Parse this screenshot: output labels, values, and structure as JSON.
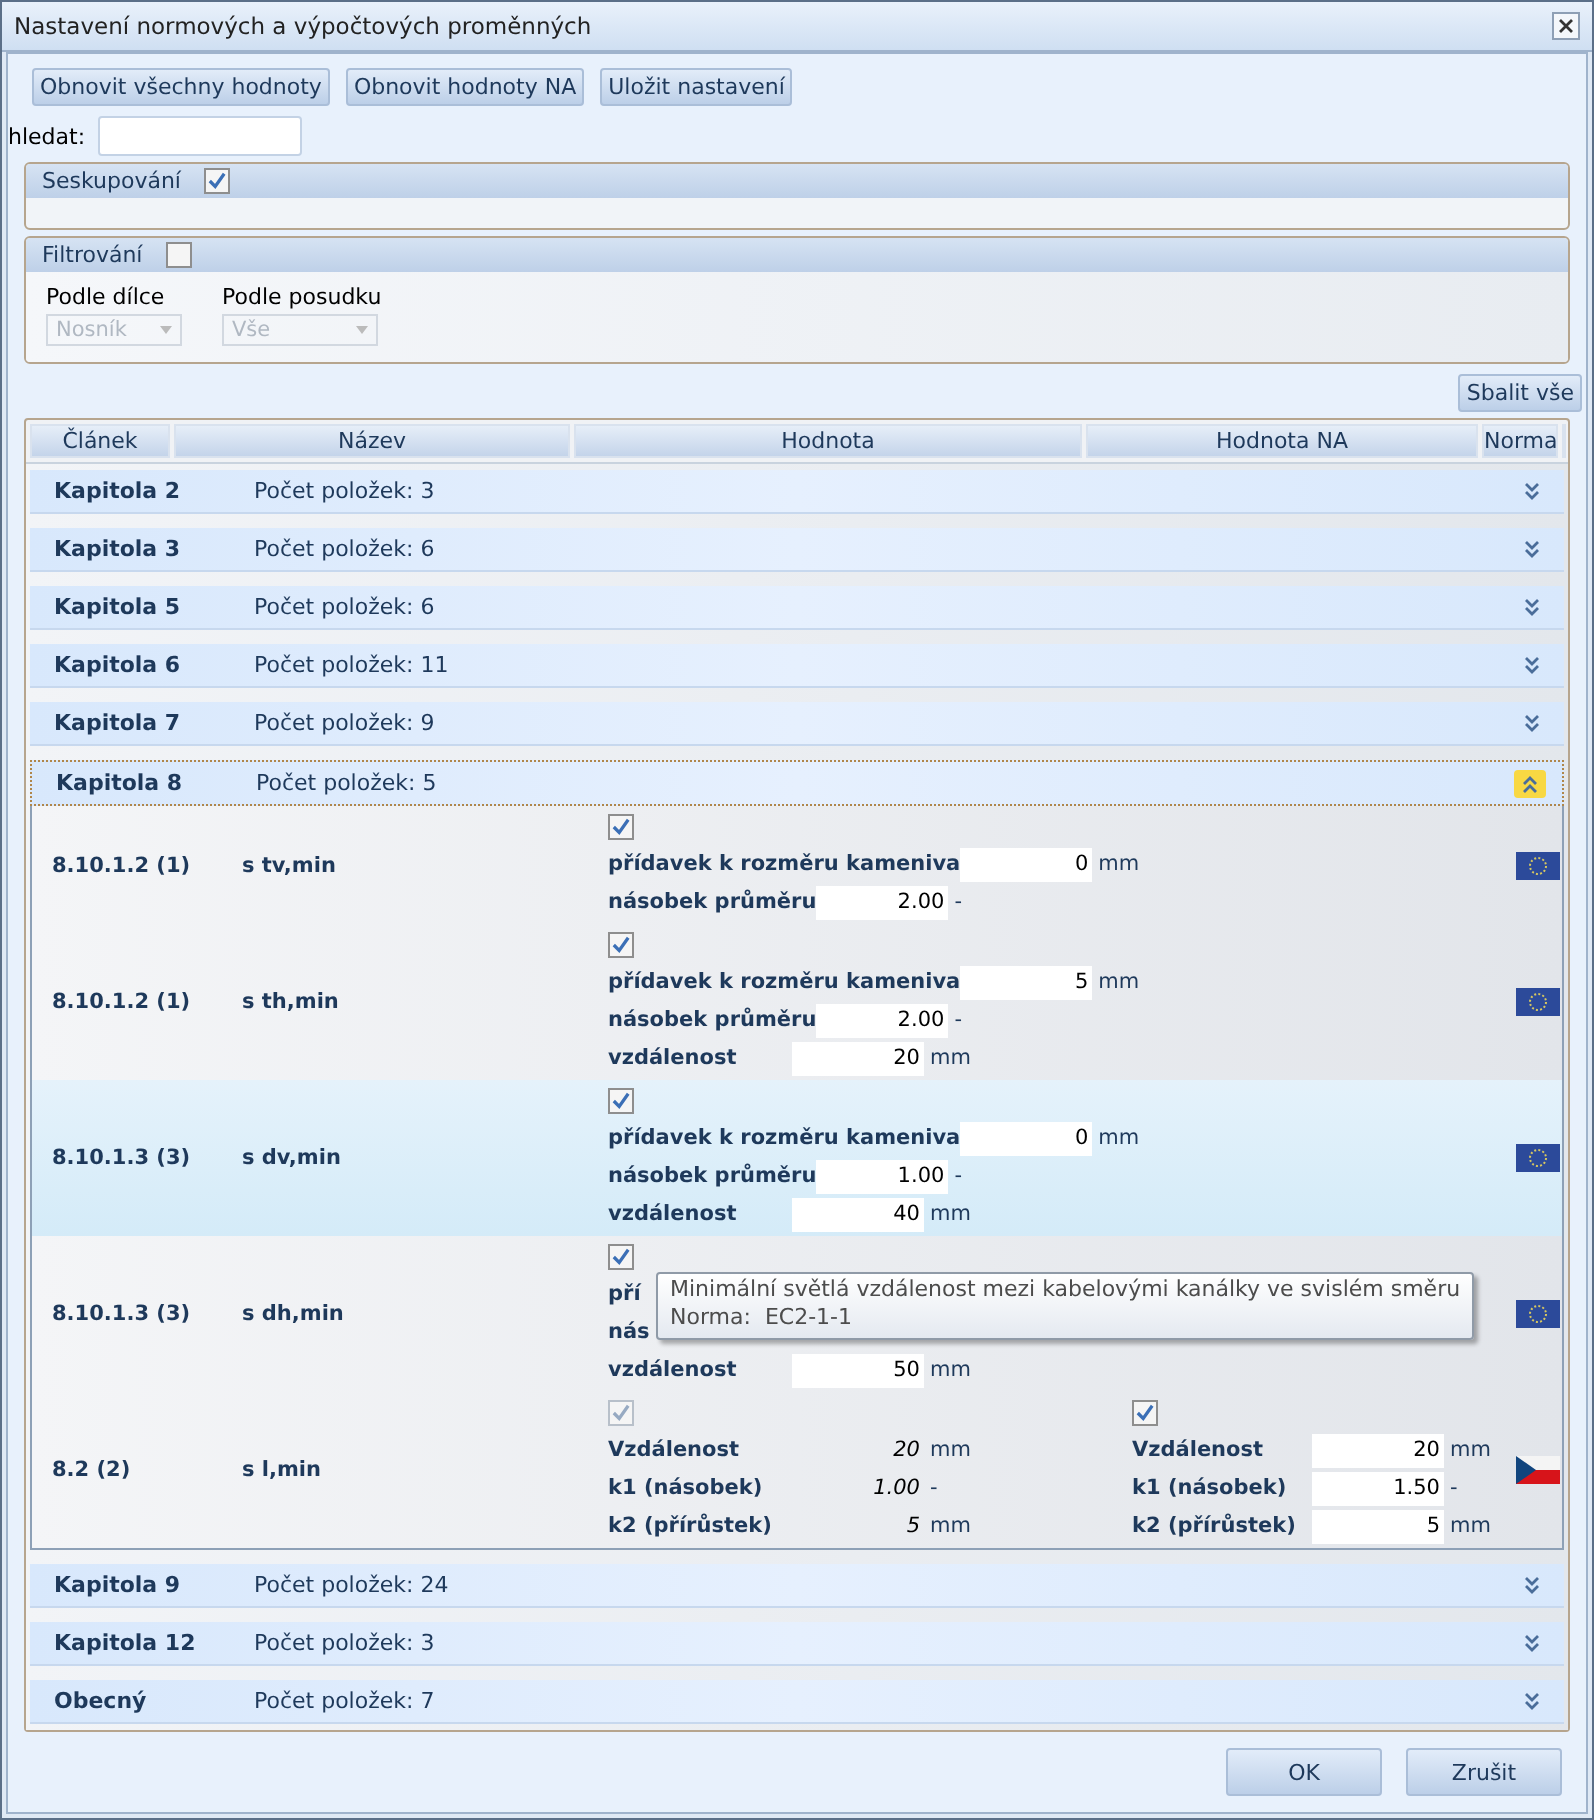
{
  "window": {
    "title": "Nastavení normových a výpočtových proměnných"
  },
  "toolbar": [
    "Obnovit všechny hodnoty",
    "Obnovit hodnoty NA",
    "Uložit nastavení"
  ],
  "search": {
    "label": "hledat:"
  },
  "grouping": {
    "title": "Seskupování",
    "checked": true
  },
  "filtering": {
    "title": "Filtrování",
    "checked": false,
    "filters": [
      {
        "label": "Podle dílce",
        "value": "Nosník",
        "disabled": true
      },
      {
        "label": "Podle posudku",
        "value": "Vše",
        "disabled": true
      }
    ]
  },
  "collapse_button": "Sbalit vše",
  "columns": [
    "Článek",
    "Název",
    "Hodnota",
    "Hodnota NA",
    "Norma"
  ],
  "groups": [
    {
      "name": "Kapitola 2",
      "count_label": "Počet položek:",
      "count": "3",
      "expanded": false
    },
    {
      "name": "Kapitola 3",
      "count_label": "Počet položek:",
      "count": "6",
      "expanded": false
    },
    {
      "name": "Kapitola 5",
      "count_label": "Počet položek:",
      "count": "6",
      "expanded": false
    },
    {
      "name": "Kapitola 6",
      "count_label": "Počet položek:",
      "count": "11",
      "expanded": false
    },
    {
      "name": "Kapitola 7",
      "count_label": "Počet položek:",
      "count": "9",
      "expanded": false
    },
    {
      "name": "Kapitola 8",
      "count_label": "Počet položek:",
      "count": "5",
      "expanded": true,
      "items": [
        {
          "article": "8.10.1.2 (1)",
          "name": "s tv,min",
          "selected": false,
          "kind": "eu",
          "value": {
            "checked": true,
            "disabled": false,
            "params": [
              {
                "label": "přídavek k rozměru kameniva",
                "value": "0",
                "unit": "mm"
              },
              {
                "label": "násobek průměru",
                "value": "2.00",
                "unit": "-"
              }
            ]
          }
        },
        {
          "article": "8.10.1.2 (1)",
          "name": "s th,min",
          "selected": false,
          "kind": "eu",
          "value": {
            "checked": true,
            "disabled": false,
            "params": [
              {
                "label": "přídavek k rozměru kameniva",
                "value": "5",
                "unit": "mm"
              },
              {
                "label": "násobek průměru",
                "value": "2.00",
                "unit": "-"
              },
              {
                "label": "vzdálenost",
                "value": "20",
                "unit": "mm"
              }
            ]
          }
        },
        {
          "article": "8.10.1.3 (3)",
          "name": "s dv,min",
          "selected": true,
          "kind": "eu",
          "value": {
            "checked": true,
            "disabled": false,
            "params": [
              {
                "label": "přídavek k rozměru kameniva",
                "value": "0",
                "unit": "mm"
              },
              {
                "label": "násobek průměru",
                "value": "1.00",
                "unit": "-"
              },
              {
                "label": "vzdálenost",
                "value": "40",
                "unit": "mm"
              }
            ]
          }
        },
        {
          "article": "8.10.1.3 (3)",
          "name": "s dh,min",
          "selected": false,
          "kind": "eu",
          "value": {
            "checked": true,
            "disabled": false,
            "params": [
              {
                "label": "pří"
              },
              {
                "label": "nás"
              },
              {
                "label": "vzdálenost",
                "value": "50",
                "unit": "mm"
              }
            ]
          },
          "tooltip": {
            "text": "Minimální světlá vzdálenost mezi kabelovými kanálky ve svislém směru",
            "norma_label": "Norma:",
            "norma": "EC2-1-1"
          }
        },
        {
          "article": "8.2 (2)",
          "name": "s l,min",
          "selected": false,
          "kind": "cz",
          "value": {
            "checked": true,
            "disabled": true,
            "params": [
              {
                "label": "Vzdálenost",
                "value": "20",
                "unit": "mm"
              },
              {
                "label": "k1 (násobek)",
                "value": "1.00",
                "unit": "-"
              },
              {
                "label": "k2 (přírůstek)",
                "value": "5",
                "unit": "mm"
              }
            ]
          },
          "na": {
            "checked": true,
            "disabled": false,
            "params": [
              {
                "label": "Vzdálenost",
                "value": "20",
                "unit": "mm"
              },
              {
                "label": "k1 (násobek)",
                "value": "1.50",
                "unit": "-"
              },
              {
                "label": "k2 (přírůstek)",
                "value": "5",
                "unit": "mm"
              }
            ]
          }
        }
      ]
    },
    {
      "name": "Kapitola 9",
      "count_label": "Počet položek:",
      "count": "24",
      "expanded": false
    },
    {
      "name": "Kapitola 12",
      "count_label": "Počet položek:",
      "count": "3",
      "expanded": false
    },
    {
      "name": "Obecný",
      "count_label": "Počet položek:",
      "count": "7",
      "expanded": false
    }
  ],
  "buttons": [
    "OK",
    "Zrušit"
  ]
}
